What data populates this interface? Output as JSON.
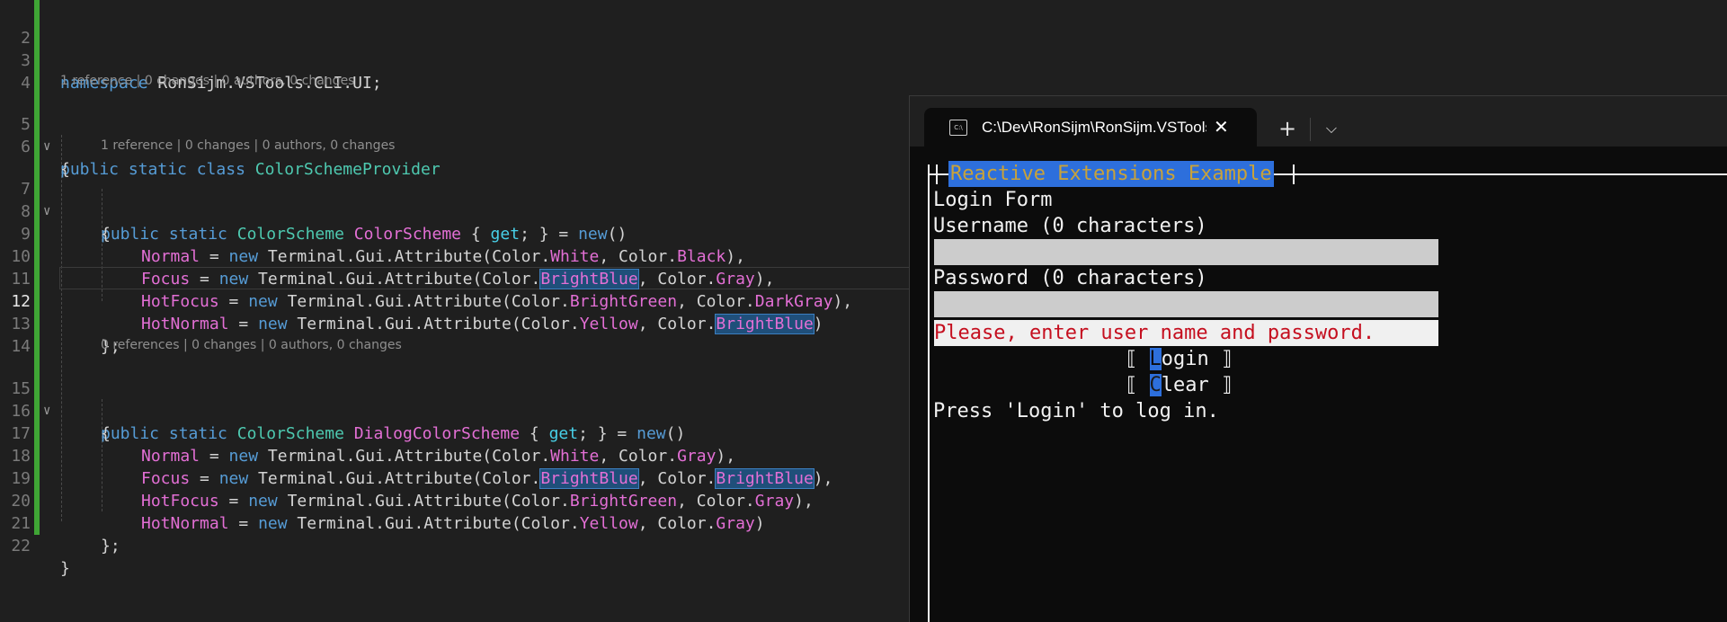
{
  "editor": {
    "lines": {
      "l2": "2",
      "l3": "3",
      "l3_kw": "namespace",
      "l3_ns": "RonSijm.VSTools.CLI.UI;",
      "l4": "4",
      "lens1": "1 reference | 0 changes | 0 authors, 0 changes",
      "l5": "5",
      "l5_kw": "public static class",
      "l5_name": "ColorSchemeProvider",
      "l6": "6",
      "l6_text": "{",
      "lens2": "1 reference | 0 changes | 0 authors, 0 changes",
      "l7": "7",
      "l7_kw": "public static",
      "l7_type": "ColorScheme",
      "l7_prop": "ColorScheme",
      "l7_open": "{ ",
      "l7_get": "get",
      "l7_mid": "; } = ",
      "l7_new": "new",
      "l7_end": "()",
      "l8": "8",
      "l8_text": "{",
      "l9": "9",
      "l9_prop": "Normal",
      "l9_eq": " = ",
      "l9_new": "new",
      "l9_call": " Terminal.Gui.Attribute(Color.",
      "l9_a": "White",
      "l9_sep": ", Color.",
      "l9_b": "Black",
      "l9_end": "),",
      "l10": "10",
      "l10_prop": "Focus",
      "l10_eq": " = ",
      "l10_new": "new",
      "l10_call": " Terminal.Gui.Attribute(Color.",
      "l10_a": "BrightBlue",
      "l10_sep": ", Color.",
      "l10_b": "Gray",
      "l10_end": "),",
      "l11": "11",
      "l11_prop": "HotFocus",
      "l11_eq": " = ",
      "l11_new": "new",
      "l11_call": " Terminal.Gui.Attribute(Color.",
      "l11_a": "BrightGreen",
      "l11_sep": ", Color.",
      "l11_b": "DarkGray",
      "l11_end": "),",
      "l12": "12",
      "l12_prop": "HotNormal",
      "l12_eq": " = ",
      "l12_new": "new",
      "l12_call": " Terminal.Gui.Attribute(Color.",
      "l12_a": "Yellow",
      "l12_sep": ", Color.",
      "l12_b": "BrightBlue",
      "l12_end": ")",
      "l13": "13",
      "l13_text": "};",
      "l14": "14",
      "lens3": "0 references | 0 changes | 0 authors, 0 changes",
      "l15": "15",
      "l15_kw": "public static",
      "l15_type": "ColorScheme",
      "l15_prop": "DialogColorScheme",
      "l15_open": "{ ",
      "l15_get": "get",
      "l15_mid": "; } = ",
      "l15_new": "new",
      "l15_end": "()",
      "l16": "16",
      "l16_text": "{",
      "l17": "17",
      "l17_prop": "Normal",
      "l17_eq": " = ",
      "l17_new": "new",
      "l17_call": " Terminal.Gui.Attribute(Color.",
      "l17_a": "White",
      "l17_sep": ", Color.",
      "l17_b": "Gray",
      "l17_end": "),",
      "l18": "18",
      "l18_prop": "Focus",
      "l18_eq": " = ",
      "l18_new": "new",
      "l18_call": " Terminal.Gui.Attribute(Color.",
      "l18_a": "BrightBlue",
      "l18_sep": ", Color.",
      "l18_b": "BrightBlue",
      "l18_end": "),",
      "l19": "19",
      "l19_prop": "HotFocus",
      "l19_eq": " = ",
      "l19_new": "new",
      "l19_call": " Terminal.Gui.Attribute(Color.",
      "l19_a": "BrightGreen",
      "l19_sep": ", Color.",
      "l19_b": "Gray",
      "l19_end": "),",
      "l20": "20",
      "l20_prop": "HotNormal",
      "l20_eq": " = ",
      "l20_new": "new",
      "l20_call": " Terminal.Gui.Attribute(Color.",
      "l20_a": "Yellow",
      "l20_sep": ", Color.",
      "l20_b": "Gray",
      "l20_end": ")",
      "l21": "21",
      "l21_text": "};",
      "l22": "22",
      "l22_text": "}"
    },
    "fold_icon": "chevron-down-icon"
  },
  "terminal": {
    "tab_title": "C:\\Dev\\RonSijm\\RonSijm.VSTools",
    "tab_icon_text": "C:\\",
    "close_glyph": "✕",
    "new_tab_glyph": "+",
    "dropdown_glyph": "⌵",
    "window_title": "Reactive Extensions Example",
    "form_title": "Login Form",
    "username_label": "Username (0 characters)",
    "username_value": "",
    "password_label": "Password (0 characters)",
    "password_value": "",
    "error_message": "Please, enter user name and password.",
    "login_button": {
      "open": "⟦ ",
      "hot": "L",
      "rest": "ogin ⟧"
    },
    "clear_button": {
      "open": "⟦ ",
      "hot": "C",
      "rest": "lear ⟧"
    },
    "hint": "Press 'Login' to log in."
  },
  "colors": {
    "editor_bg": "#1f1f1f",
    "terminal_bg": "#0c0c0c",
    "keyword": "#569cd6",
    "type": "#4ec9b0",
    "property": "#e36fd5",
    "accessor": "#48d0e8",
    "error_text": "#c50f1f",
    "hotkey_bg": "#2d6fdc",
    "title_text": "#c8a23a"
  }
}
